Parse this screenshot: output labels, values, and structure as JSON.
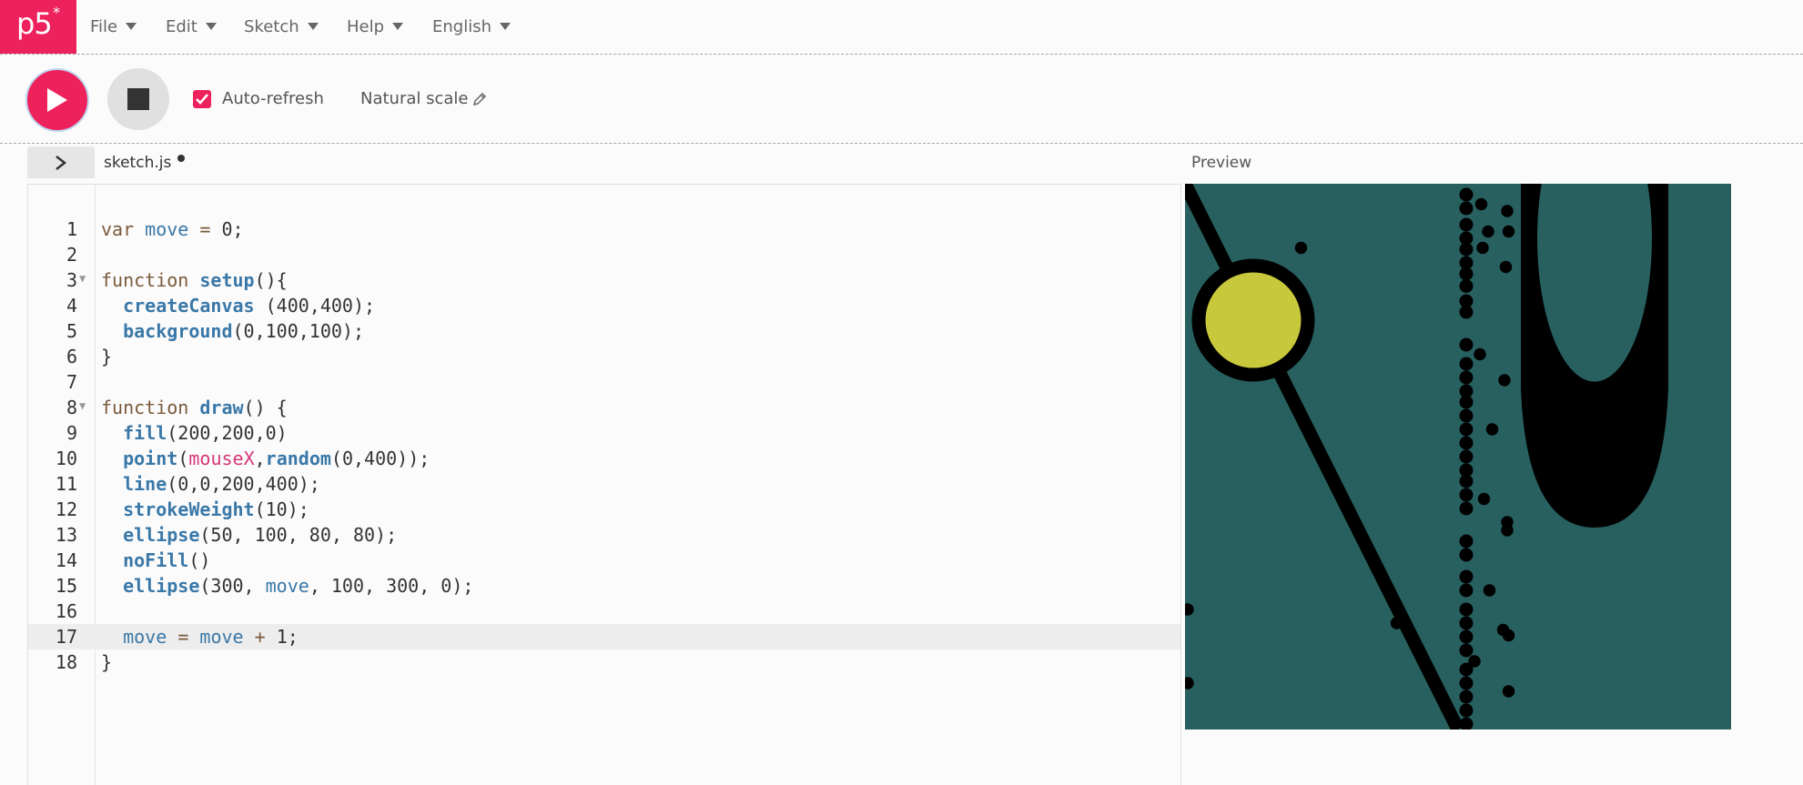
{
  "app": {
    "logo_text": "p5",
    "logo_star": "*"
  },
  "menu": [
    {
      "label": "File"
    },
    {
      "label": "Edit"
    },
    {
      "label": "Sketch"
    },
    {
      "label": "Help"
    },
    {
      "label": "English"
    }
  ],
  "toolbar": {
    "play_icon": "play-icon",
    "stop_icon": "stop-icon",
    "auto_refresh_label": "Auto-refresh",
    "auto_refresh_checked": true,
    "sketch_name": "Natural scale"
  },
  "editor": {
    "file_name": "sketch.js",
    "unsaved": true,
    "active_line": 17,
    "line_numbers": [
      "1",
      "2",
      "3",
      "4",
      "5",
      "6",
      "7",
      "8",
      "9",
      "10",
      "11",
      "12",
      "13",
      "14",
      "15",
      "16",
      "17",
      "18"
    ],
    "lines": [
      "var move = 0;",
      "",
      "function setup(){",
      "  createCanvas (400,400);",
      "  background(0,100,100);",
      "}",
      "",
      "function draw() {",
      "  fill(200,200,0)",
      "  point(mouseX,random(0,400));",
      "  line(0,0,200,400);",
      "  strokeWeight(10);",
      "  ellipse(50, 100, 80, 80);",
      "  noFill()",
      "  ellipse(300, move, 100, 300, 0);",
      "",
      "  move = move + 1;",
      "}"
    ]
  },
  "preview": {
    "title": "Preview",
    "background": "#286060",
    "fill": "#c8c83c"
  },
  "colors": {
    "accent": "#ed225d"
  }
}
